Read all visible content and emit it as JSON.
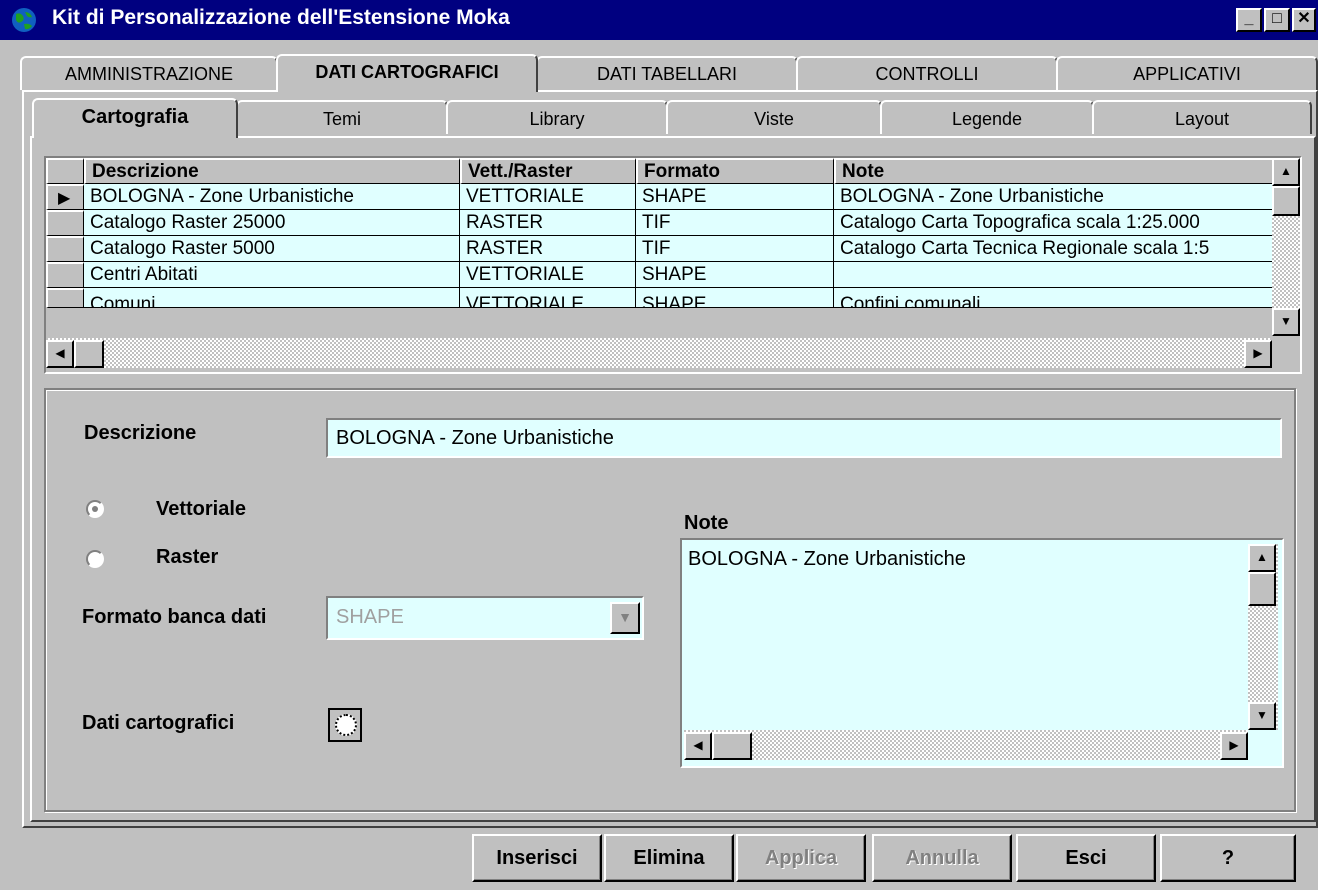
{
  "window": {
    "title": "Kit di Personalizzazione dell'Estensione Moka",
    "icon": "globe-icon"
  },
  "main_tabs": [
    {
      "label": "AMMINISTRAZIONE",
      "selected": false
    },
    {
      "label": "DATI CARTOGRAFICI",
      "selected": true
    },
    {
      "label": "DATI TABELLARI",
      "selected": false
    },
    {
      "label": "CONTROLLI",
      "selected": false
    },
    {
      "label": "APPLICATIVI",
      "selected": false
    }
  ],
  "sub_tabs": [
    {
      "label": "Cartografia",
      "selected": true
    },
    {
      "label": "Temi",
      "selected": false
    },
    {
      "label": "Library",
      "selected": false
    },
    {
      "label": "Viste",
      "selected": false
    },
    {
      "label": "Legende",
      "selected": false
    },
    {
      "label": "Layout",
      "selected": false
    }
  ],
  "grid": {
    "columns": [
      "Descrizione",
      "Vett./Raster",
      "Formato",
      "Note"
    ],
    "rows": [
      {
        "descrizione": "BOLOGNA - Zone Urbanistiche",
        "tipo": "VETTORIALE",
        "formato": "SHAPE",
        "note": "BOLOGNA - Zone Urbanistiche",
        "current": true
      },
      {
        "descrizione": "Catalogo Raster 25000",
        "tipo": "RASTER",
        "formato": "TIF",
        "note": "Catalogo Carta Topografica scala 1:25.000",
        "current": false
      },
      {
        "descrizione": "Catalogo Raster 5000",
        "tipo": "RASTER",
        "formato": "TIF",
        "note": "Catalogo Carta Tecnica Regionale scala 1:5",
        "current": false
      },
      {
        "descrizione": "Centri Abitati",
        "tipo": "VETTORIALE",
        "formato": "SHAPE",
        "note": "",
        "current": false
      },
      {
        "descrizione": "Comuni",
        "tipo": "VETTORIALE",
        "formato": "SHAPE",
        "note": "Confini comunali",
        "current": false
      }
    ]
  },
  "form": {
    "descrizione_label": "Descrizione",
    "descrizione_value": "BOLOGNA - Zone Urbanistiche",
    "radio_vettoriale": "Vettoriale",
    "radio_raster": "Raster",
    "selected_type": "Vettoriale",
    "formato_label": "Formato banca dati",
    "formato_value": "SHAPE",
    "dati_label": "Dati cartografici",
    "note_label": "Note",
    "note_value": "BOLOGNA - Zone Urbanistiche"
  },
  "buttons": {
    "inserisci": "Inserisci",
    "elimina": "Elimina",
    "applica": "Applica",
    "annulla": "Annulla",
    "esci": "Esci",
    "help": "?"
  },
  "colors": {
    "title_bar": "#000080",
    "field_bg": "#e0ffff",
    "face": "#c0c0c0"
  }
}
